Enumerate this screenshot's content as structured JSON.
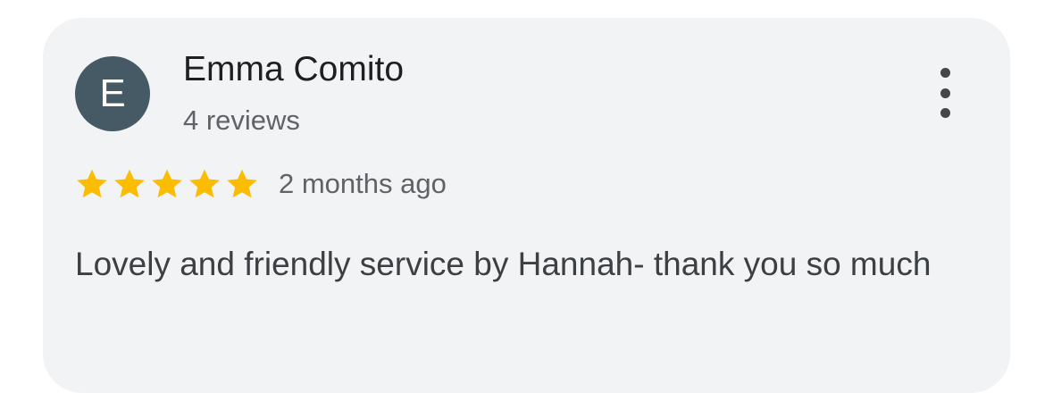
{
  "review": {
    "avatar_initial": "E",
    "author_name": "Emma Comito",
    "author_reviews": "4 reviews",
    "rating": 5,
    "rating_max": 5,
    "time_ago": "2 months ago",
    "text": "Lovely and friendly service by Hannah- thank you so much",
    "more_options_icon": "more-vert-icon",
    "star_icon": "star-icon"
  },
  "colors": {
    "avatar_bg": "#455a64",
    "star": "#fbbc04",
    "card_bg": "#f2f3f5"
  }
}
